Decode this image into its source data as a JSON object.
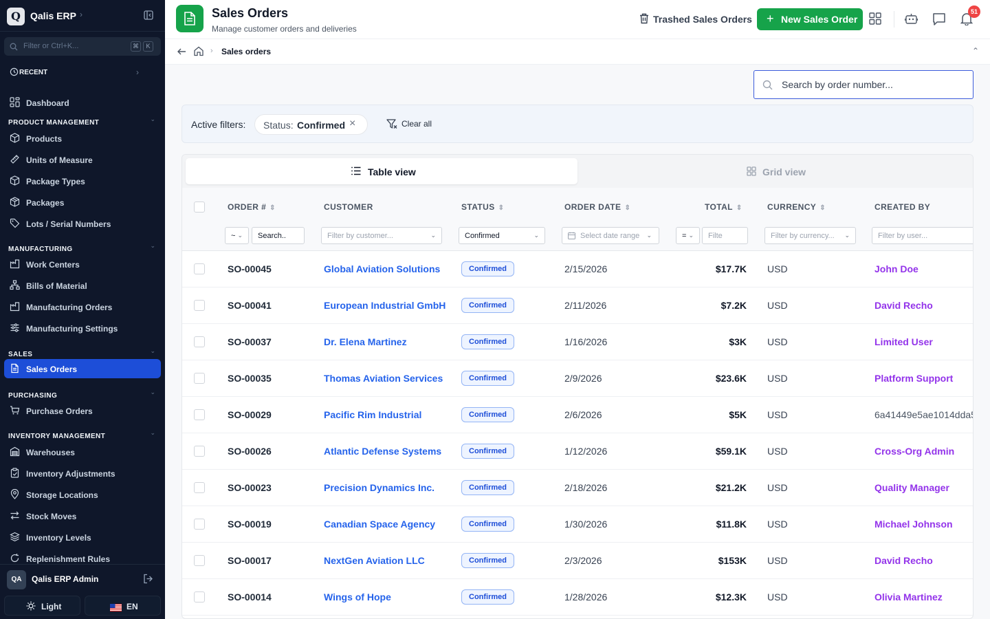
{
  "app": {
    "brand_letter": "Q",
    "brand_name": "Qalis ERP",
    "filter_placeholder": "Filter or Ctrl+K...",
    "kbd1": "⌘",
    "kbd2": "K"
  },
  "sidebar": {
    "recent": "RECENT",
    "dashboard": "Dashboard",
    "sections": {
      "product": "PRODUCT MANAGEMENT",
      "manufacturing": "MANUFACTURING",
      "sales": "SALES",
      "purchasing": "PURCHASING",
      "inventory": "INVENTORY MANAGEMENT"
    },
    "product_items": [
      "Products",
      "Units of Measure",
      "Package Types",
      "Packages",
      "Lots / Serial Numbers"
    ],
    "manufacturing_items": [
      "Work Centers",
      "Bills of Material",
      "Manufacturing Orders",
      "Manufacturing Settings"
    ],
    "sales_items": [
      "Sales Orders"
    ],
    "purchasing_items": [
      "Purchase Orders"
    ],
    "inventory_items": [
      "Warehouses",
      "Inventory Adjustments",
      "Storage Locations",
      "Stock Moves",
      "Inventory Levels",
      "Replenishment Rules"
    ],
    "user_initials": "QA",
    "user_name": "Qalis ERP Admin",
    "theme_label": "Light",
    "lang_label": "EN"
  },
  "header": {
    "title": "Sales Orders",
    "subtitle": "Manage customer orders and deliveries",
    "trash_label": "Trashed Sales Orders",
    "new_label": "New Sales Order",
    "notif_count": "51"
  },
  "breadcrumb": {
    "current": "Sales orders"
  },
  "search": {
    "placeholder": "Search by order number..."
  },
  "filters": {
    "label": "Active filters:",
    "chip_key": "Status:",
    "chip_value": "Confirmed",
    "clear_label": "Clear all"
  },
  "views": {
    "table": "Table view",
    "grid": "Grid view"
  },
  "table": {
    "columns": [
      "ORDER #",
      "CUSTOMER",
      "STATUS",
      "ORDER DATE",
      "TOTAL",
      "CURRENCY",
      "CREATED BY"
    ],
    "filter_row": {
      "order_op": "~",
      "order_search": "Search..",
      "customer": "Filter by customer...",
      "status": "Confirmed",
      "date": "Select date range",
      "total_op": "=",
      "total_filter": "Filte",
      "currency": "Filter by currency...",
      "user": "Filter by user..."
    },
    "rows": [
      {
        "order": "SO-00045",
        "customer": "Global Aviation Solutions",
        "status": "Confirmed",
        "date": "2/15/2026",
        "total": "$17.7K",
        "currency": "USD",
        "user": "John Doe"
      },
      {
        "order": "SO-00041",
        "customer": "European Industrial GmbH",
        "status": "Confirmed",
        "date": "2/11/2026",
        "total": "$7.2K",
        "currency": "USD",
        "user": "David Recho"
      },
      {
        "order": "SO-00037",
        "customer": "Dr. Elena Martinez",
        "status": "Confirmed",
        "date": "1/16/2026",
        "total": "$3K",
        "currency": "USD",
        "user": "Limited User"
      },
      {
        "order": "SO-00035",
        "customer": "Thomas Aviation Services",
        "status": "Confirmed",
        "date": "2/9/2026",
        "total": "$23.6K",
        "currency": "USD",
        "user": "Platform Support"
      },
      {
        "order": "SO-00029",
        "customer": "Pacific Rim Industrial",
        "status": "Confirmed",
        "date": "2/6/2026",
        "total": "$5K",
        "currency": "USD",
        "user": "6a41449e5ae1014dda5"
      },
      {
        "order": "SO-00026",
        "customer": "Atlantic Defense Systems",
        "status": "Confirmed",
        "date": "1/12/2026",
        "total": "$59.1K",
        "currency": "USD",
        "user": "Cross-Org Admin"
      },
      {
        "order": "SO-00023",
        "customer": "Precision Dynamics Inc.",
        "status": "Confirmed",
        "date": "2/18/2026",
        "total": "$21.2K",
        "currency": "USD",
        "user": "Quality Manager"
      },
      {
        "order": "SO-00019",
        "customer": "Canadian Space Agency",
        "status": "Confirmed",
        "date": "1/30/2026",
        "total": "$11.8K",
        "currency": "USD",
        "user": "Michael Johnson"
      },
      {
        "order": "SO-00017",
        "customer": "NextGen Aviation LLC",
        "status": "Confirmed",
        "date": "2/3/2026",
        "total": "$153K",
        "currency": "USD",
        "user": "David Recho"
      },
      {
        "order": "SO-00014",
        "customer": "Wings of Hope",
        "status": "Confirmed",
        "date": "1/28/2026",
        "total": "$12.3K",
        "currency": "USD",
        "user": "Olivia Martinez"
      }
    ]
  },
  "colors": {
    "accent_green": "#16a34a",
    "active_blue": "#1d4ed8",
    "link_blue": "#2563eb",
    "user_purple": "#9333ea",
    "sidebar_bg": "#0f172a"
  }
}
